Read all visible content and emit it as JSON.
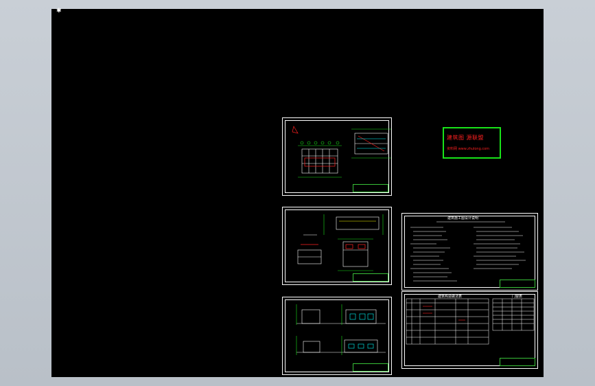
{
  "viewport": {
    "ucs_marker": "✱"
  },
  "stamp": {
    "line1": "建筑图 源联盟",
    "line2": "资料网 www.zhulong.com"
  },
  "sheets": {
    "plan": {
      "name": "floor-plan-sheet"
    },
    "section": {
      "name": "section-sheet"
    },
    "elevation": {
      "name": "elevation-sheet"
    },
    "spec": {
      "title": "建筑施工图设计说明"
    },
    "schedule": {
      "title": "建筑构造做法表",
      "side_title": "门窗表"
    }
  },
  "colors": {
    "viewport": "#000000",
    "line": "#ffffff",
    "green": "#19e419",
    "red": "#ff2020",
    "cyan": "#00ffff",
    "yellow": "#ffff00"
  }
}
